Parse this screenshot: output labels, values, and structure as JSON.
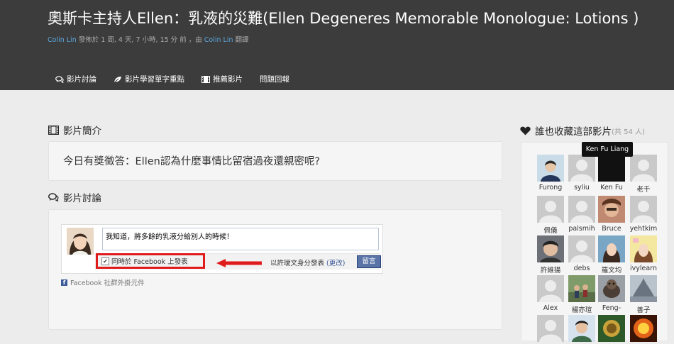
{
  "header": {
    "title": "奧斯卡主持人Ellen：乳液的災難(Ellen Degeneres Memorable Monologue: Lotions )",
    "meta": {
      "author": "Colin Lin",
      "posted": " 發佈於 1 周, 4 天, 7 小時, 15 分 前 ，由 ",
      "translator": "Colin Lin",
      "suffix": " 翻譯"
    }
  },
  "nav": [
    {
      "label": "影片討論",
      "icon": "comments-icon"
    },
    {
      "label": "影片學習單字重點",
      "icon": "leaf-icon"
    },
    {
      "label": "推薦影片",
      "icon": "film-icon"
    },
    {
      "label": "問題回報",
      "icon": ""
    }
  ],
  "intro": {
    "heading": "影片簡介",
    "text": "今日有獎徵答：Ellen認為什麼事情比留宿過夜還親密呢?"
  },
  "discussion": {
    "heading": "影片討論",
    "comment_text": "我知道，將多餘的乳液分給別人的時候！",
    "checkbox_label": "同時於 Facebook 上發表",
    "identity_text": "以許璦文身分發表",
    "change_link": "(更改)",
    "post_button": "留言",
    "plugin_label": "Facebook 社群外掛元件"
  },
  "favorites": {
    "heading": "誰也收藏這部影片",
    "count_text": "(共 54 人)",
    "tooltip": "Ken Fu Liang",
    "users": [
      {
        "name": "Furong"
      },
      {
        "name": "syliu"
      },
      {
        "name": "Ken Fu"
      },
      {
        "name": "老千"
      },
      {
        "name": "佩儀"
      },
      {
        "name": "palsmih"
      },
      {
        "name": "Bruce"
      },
      {
        "name": "yehtkim"
      },
      {
        "name": "許維揚"
      },
      {
        "name": "debs"
      },
      {
        "name": "羅文均"
      },
      {
        "name": "ivylearn"
      },
      {
        "name": "Alex"
      },
      {
        "name": "楊亦瑄"
      },
      {
        "name": "Feng-"
      },
      {
        "name": "善子"
      },
      {
        "name": ""
      },
      {
        "name": ""
      },
      {
        "name": ""
      },
      {
        "name": ""
      }
    ]
  }
}
